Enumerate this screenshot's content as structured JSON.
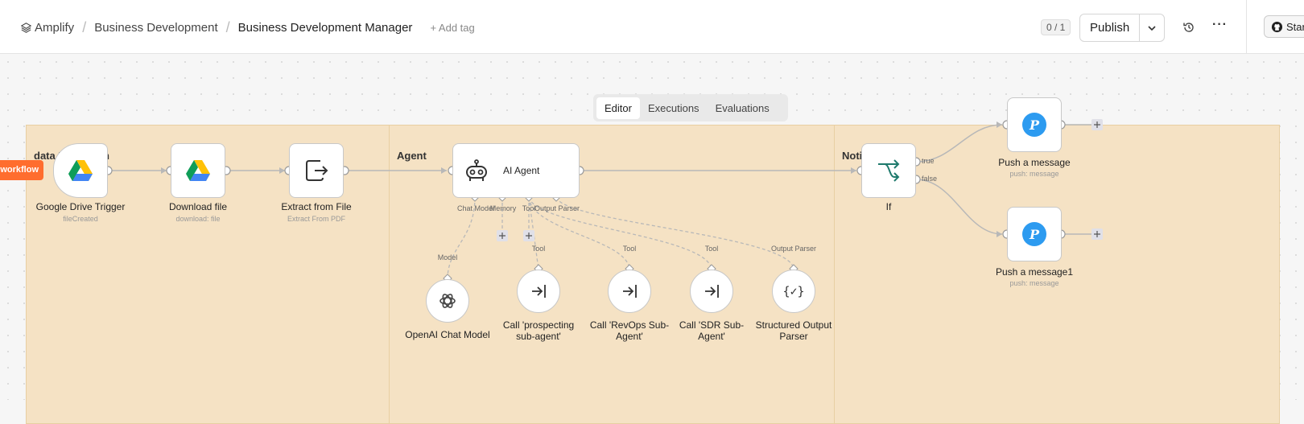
{
  "header": {
    "project": "Amplify",
    "folder": "Business Development",
    "workflow_name": "Business Development Manager",
    "add_tag": "+ Add tag",
    "counter": "0 / 1",
    "publish_label": "Publish",
    "star_label": "Star"
  },
  "tabs": [
    {
      "label": "Editor",
      "active": true
    },
    {
      "label": "Executions",
      "active": false
    },
    {
      "label": "Evaluations",
      "active": false
    }
  ],
  "workflow_tag": "workflow",
  "groups": [
    {
      "title": "data Extraction"
    },
    {
      "title": "Agent"
    },
    {
      "title": "Notification"
    }
  ],
  "nodes": {
    "trigger": {
      "label": "Google Drive Trigger",
      "sub": "fileCreated"
    },
    "download": {
      "label": "Download file",
      "sub": "download: file"
    },
    "extract": {
      "label": "Extract from File",
      "sub": "Extract From PDF"
    },
    "agent": {
      "label": "AI Agent",
      "ports": [
        "Chat Model",
        "Memory",
        "Tool",
        "Output Parser"
      ]
    },
    "openai": {
      "label": "OpenAI Chat Model",
      "port": "Model"
    },
    "prospecting": {
      "label": "Call 'prospecting sub-agent'",
      "port": "Tool"
    },
    "revops": {
      "label": "Call 'RevOps Sub-Agent'",
      "port": "Tool"
    },
    "sdr": {
      "label": "Call 'SDR Sub-Agent'",
      "port": "Tool"
    },
    "parser": {
      "label": "Structured Output Parser",
      "port": "Output Parser"
    },
    "if": {
      "label": "If",
      "true_label": "true",
      "false_label": "false"
    },
    "push1": {
      "label": "Push a message",
      "sub": "push: message"
    },
    "push2": {
      "label": "Push a message1",
      "sub": "push: message"
    }
  },
  "colors": {
    "sticky": "#f5e2c4",
    "workflow_tag": "#ff6d2e",
    "pushover": "#2d9bf0",
    "if_icon": "#1f7a6d"
  }
}
